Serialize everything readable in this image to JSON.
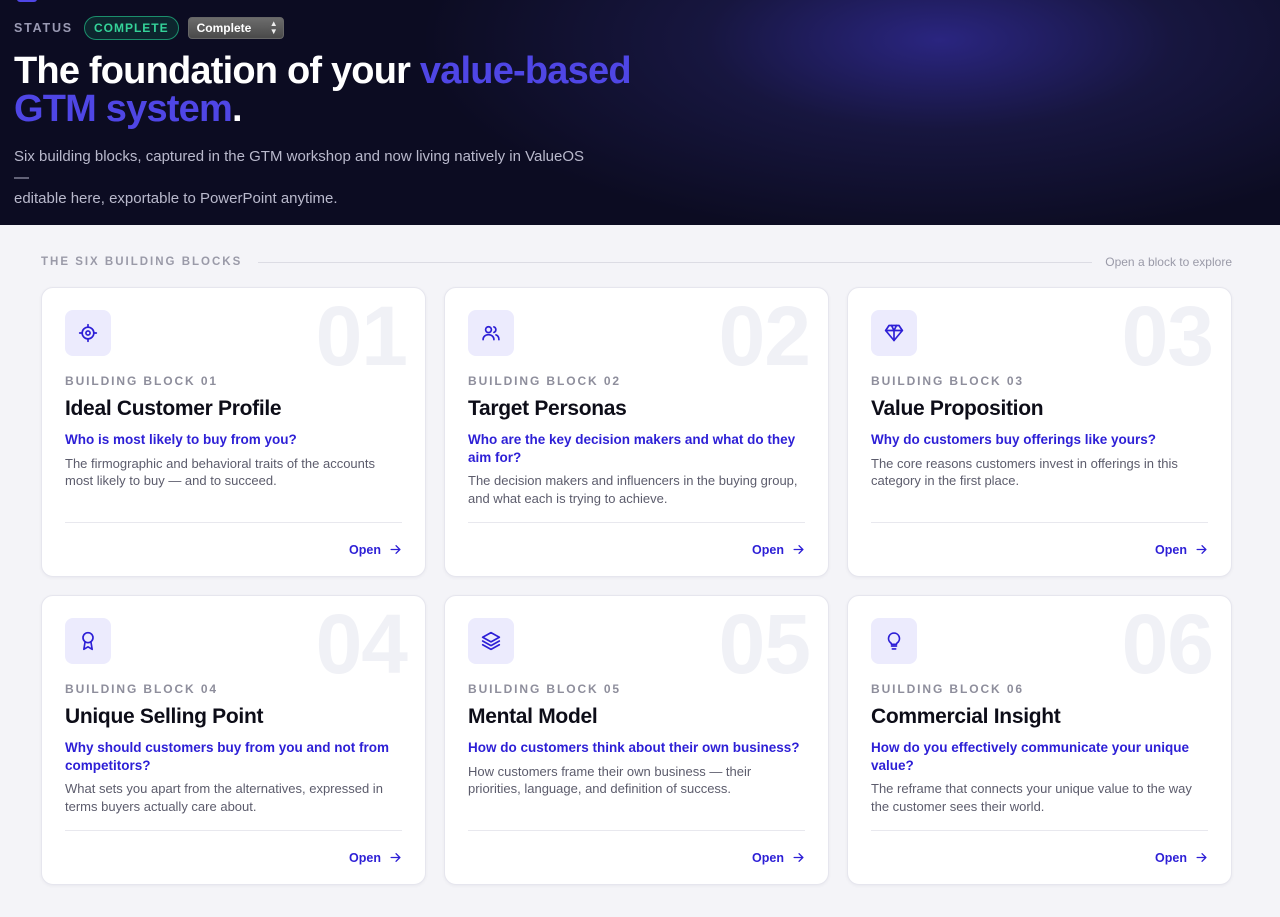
{
  "header": {
    "status_label": "STATUS",
    "status_badge": "COMPLETE",
    "status_select_value": "Complete",
    "title_part1": "The foundation of your ",
    "title_accent_line1": "value-based",
    "title_accent_line2": "GTM system",
    "title_end": ".",
    "subtitle_line1": "Six building blocks, captured in the GTM workshop and now living natively in ValueOS —",
    "subtitle_line2": "editable here, exportable to PowerPoint anytime."
  },
  "section": {
    "title": "THE SIX BUILDING BLOCKS",
    "hint": "Open a block to explore"
  },
  "cards": [
    {
      "number": "01",
      "icon": "target-icon",
      "eyebrow": "BUILDING BLOCK 01",
      "title": "Ideal Customer Profile",
      "question": "Who is most likely to buy from you?",
      "description": "The firmographic and behavioral traits of the accounts most likely to buy — and to succeed.",
      "action": "Open"
    },
    {
      "number": "02",
      "icon": "users-icon",
      "eyebrow": "BUILDING BLOCK 02",
      "title": "Target Personas",
      "question": "Who are the key decision makers and what do they aim for?",
      "description": "The decision makers and influencers in the buying group, and what each is trying to achieve.",
      "action": "Open"
    },
    {
      "number": "03",
      "icon": "diamond-icon",
      "eyebrow": "BUILDING BLOCK 03",
      "title": "Value Proposition",
      "question": "Why do customers buy offerings like yours?",
      "description": "The core reasons customers invest in offerings in this category in the first place.",
      "action": "Open"
    },
    {
      "number": "04",
      "icon": "award-icon",
      "eyebrow": "BUILDING BLOCK 04",
      "title": "Unique Selling Point",
      "question": "Why should customers buy from you and not from competitors?",
      "description": "What sets you apart from the alternatives, expressed in terms buyers actually care about.",
      "action": "Open"
    },
    {
      "number": "05",
      "icon": "layers-icon",
      "eyebrow": "BUILDING BLOCK 05",
      "title": "Mental Model",
      "question": "How do customers think about their own business?",
      "description": "How customers frame their own business — their priorities, language, and definition of success.",
      "action": "Open"
    },
    {
      "number": "06",
      "icon": "lightbulb-icon",
      "eyebrow": "BUILDING BLOCK 06",
      "title": "Commercial Insight",
      "question": "How do you effectively communicate your unique value?",
      "description": "The reframe that connects your unique value to the way the customer sees their world.",
      "action": "Open"
    }
  ]
}
